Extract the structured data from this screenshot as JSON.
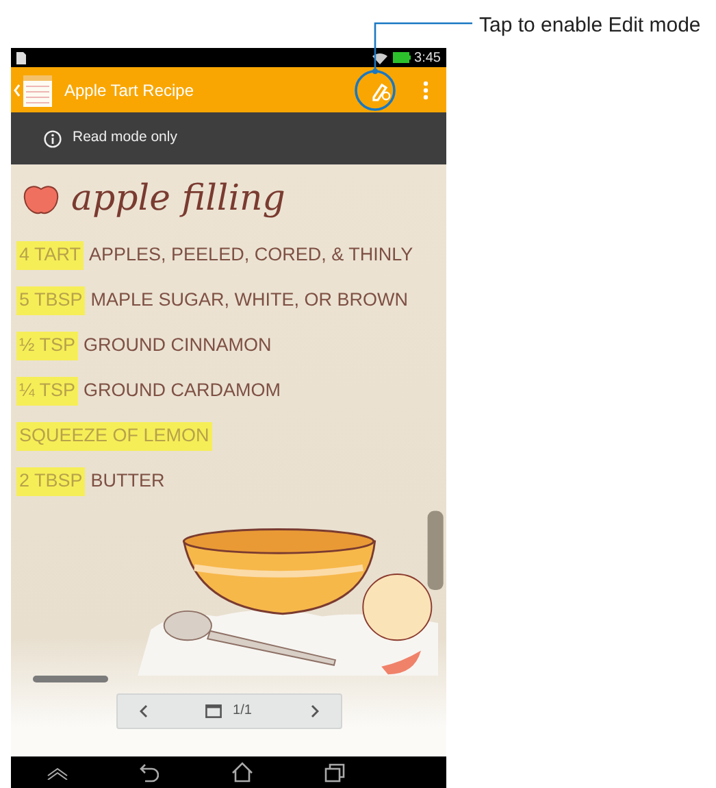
{
  "callout": {
    "text": "Tap to enable Edit mode"
  },
  "status_bar": {
    "time": "3:45"
  },
  "app_bar": {
    "title": "Apple Tart Recipe"
  },
  "info_bar": {
    "text": "Read mode only"
  },
  "note": {
    "title": "apple filling",
    "lines": [
      {
        "highlight": "4 TART",
        "text": "APPLES, PEELED, CORED, & THINLY"
      },
      {
        "highlight": "5 TBSP",
        "text": "MAPLE SUGAR, WHITE, OR BROWN"
      },
      {
        "highlight": "½ TSP",
        "text": "GROUND CINNAMON"
      },
      {
        "highlight": "¼ TSP",
        "text": "GROUND CARDAMOM"
      },
      {
        "highlight": "SQUEEZE OF LEMON"
      },
      {
        "highlight": "2 TBSP",
        "text": "BUTTER"
      }
    ]
  },
  "pager": {
    "page": "1/1"
  }
}
